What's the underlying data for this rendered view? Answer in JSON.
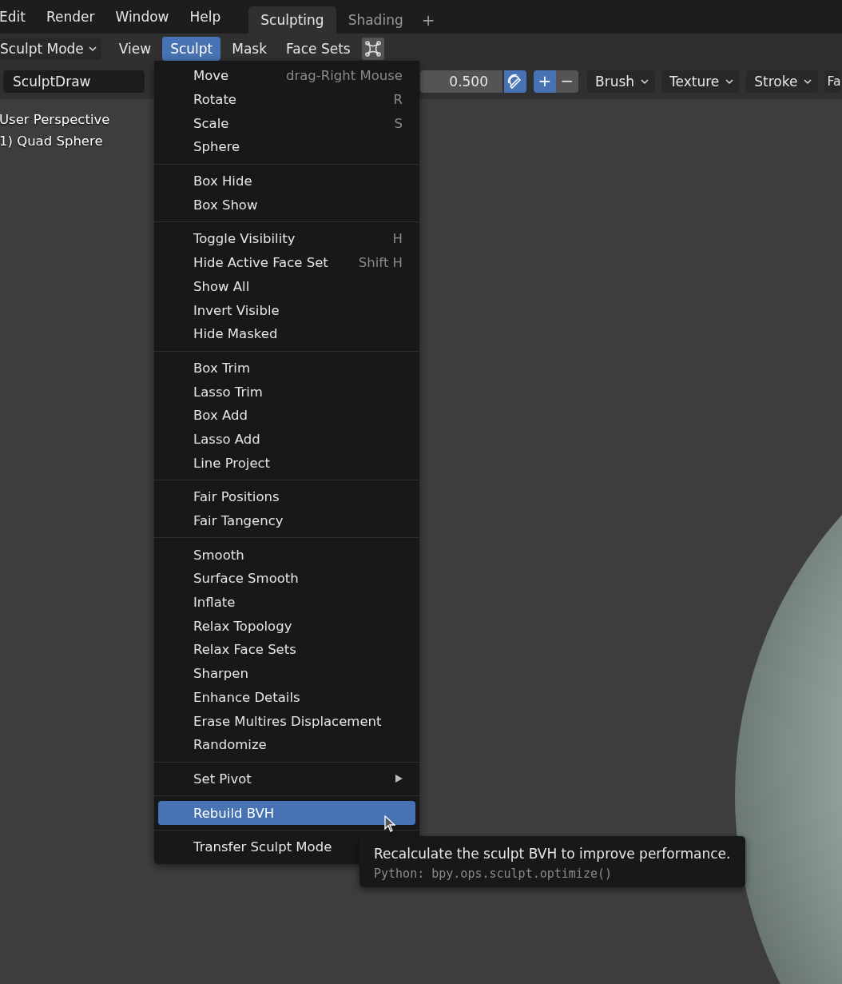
{
  "topbar": {
    "menus": [
      "Edit",
      "Render",
      "Window",
      "Help"
    ],
    "workspace_tabs": [
      {
        "label": "Sculpting",
        "selected": true
      },
      {
        "label": "Shading",
        "selected": false
      }
    ],
    "add_tab": "+"
  },
  "header": {
    "mode": "Sculpt Mode",
    "menus": [
      {
        "label": "View",
        "selected": false
      },
      {
        "label": "Sculpt",
        "selected": true
      },
      {
        "label": "Mask",
        "selected": false
      },
      {
        "label": "Face Sets",
        "selected": false
      }
    ]
  },
  "tool_settings": {
    "brush_name": "SculptDraw",
    "strength": "0.500",
    "direction": [
      {
        "label": "+",
        "selected": true
      },
      {
        "label": "−",
        "selected": false
      }
    ],
    "dropdowns": [
      "Brush",
      "Texture",
      "Stroke",
      "Fa"
    ]
  },
  "viewport": {
    "view_name": "User Perspective",
    "object_name": "1) Quad Sphere"
  },
  "menu": {
    "sections": [
      [
        {
          "label": "Move",
          "shortcut": "drag-Right Mouse",
          "kind": "action",
          "selected": false
        },
        {
          "label": "Rotate",
          "shortcut": "R",
          "kind": "action",
          "selected": false
        },
        {
          "label": "Scale",
          "shortcut": "S",
          "kind": "action",
          "selected": false
        },
        {
          "label": "Sphere",
          "kind": "action",
          "selected": false
        }
      ],
      [
        {
          "label": "Box Hide",
          "kind": "action",
          "selected": false
        },
        {
          "label": "Box Show",
          "kind": "action",
          "selected": false
        }
      ],
      [
        {
          "label": "Toggle Visibility",
          "shortcut": "H",
          "kind": "action",
          "selected": false
        },
        {
          "label": "Hide Active Face Set",
          "shortcut": "Shift H",
          "kind": "action",
          "selected": false
        },
        {
          "label": "Show All",
          "kind": "action",
          "selected": false
        },
        {
          "label": "Invert Visible",
          "kind": "action",
          "selected": false
        },
        {
          "label": "Hide Masked",
          "kind": "action",
          "selected": false
        }
      ],
      [
        {
          "label": "Box Trim",
          "kind": "action",
          "selected": false
        },
        {
          "label": "Lasso Trim",
          "kind": "action",
          "selected": false
        },
        {
          "label": "Box Add",
          "kind": "action",
          "selected": false
        },
        {
          "label": "Lasso Add",
          "kind": "action",
          "selected": false
        },
        {
          "label": "Line Project",
          "kind": "action",
          "selected": false
        }
      ],
      [
        {
          "label": "Fair Positions",
          "kind": "action",
          "selected": false
        },
        {
          "label": "Fair Tangency",
          "kind": "action",
          "selected": false
        }
      ],
      [
        {
          "label": "Smooth",
          "kind": "action",
          "selected": false
        },
        {
          "label": "Surface Smooth",
          "kind": "action",
          "selected": false
        },
        {
          "label": "Inflate",
          "kind": "action",
          "selected": false
        },
        {
          "label": "Relax Topology",
          "kind": "action",
          "selected": false
        },
        {
          "label": "Relax Face Sets",
          "kind": "action",
          "selected": false
        },
        {
          "label": "Sharpen",
          "kind": "action",
          "selected": false
        },
        {
          "label": "Enhance Details",
          "kind": "action",
          "selected": false
        },
        {
          "label": "Erase Multires Displacement",
          "kind": "action",
          "selected": false
        },
        {
          "label": "Randomize",
          "kind": "action",
          "selected": false
        }
      ],
      [
        {
          "label": "Set Pivot",
          "kind": "submenu",
          "selected": false
        }
      ],
      [
        {
          "label": "Rebuild BVH",
          "kind": "action",
          "selected": true
        }
      ],
      [
        {
          "label": "Transfer Sculpt Mode",
          "kind": "action",
          "selected": false
        }
      ]
    ]
  },
  "tooltip": {
    "description": "Recalculate the sculpt BVH to improve performance.",
    "python": "Python: bpy.ops.sculpt.optimize()"
  }
}
